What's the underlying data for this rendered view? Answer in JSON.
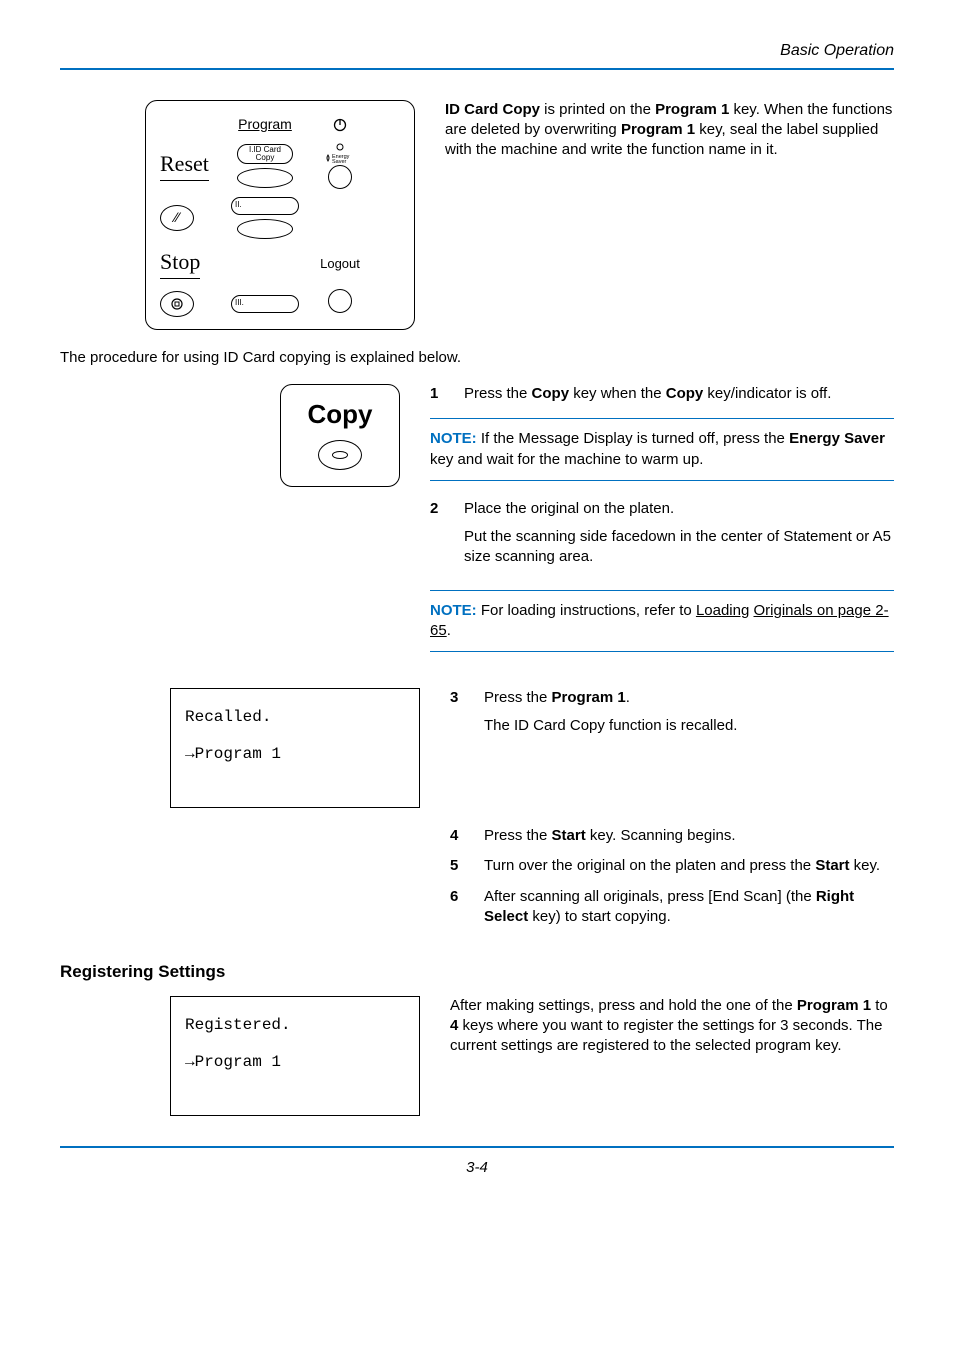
{
  "header": {
    "section": "Basic Operation"
  },
  "panel": {
    "reset": "Reset",
    "stop": "Stop",
    "program": "Program",
    "id_card_copy": "I.ID Card Copy",
    "energy_saver": "Energy\nSaver",
    "logout": "Logout",
    "slot2_prefix": "II.",
    "slot3_prefix": "III."
  },
  "intro_paragraph": {
    "pre1": "ID Card Copy",
    "mid1": " is printed on the ",
    "b2": "Program 1",
    "mid2": " key. When the functions are deleted by overwriting ",
    "b3": "Program 1",
    "post": " key, seal the label supplied with the machine and write the function name in it."
  },
  "procedure_intro": "The procedure for using ID Card copying is explained below.",
  "copy_box_title": "Copy",
  "steps": {
    "s1": {
      "num": "1",
      "pre": "Press the ",
      "b1": "Copy",
      "mid": " key when the ",
      "b2": "Copy",
      "post": " key/indicator is off."
    },
    "note1": {
      "label": "NOTE:",
      "pre": " If the Message Display is turned off, press the ",
      "b": "Energy Saver",
      "post": " key and wait for the machine to warm up."
    },
    "s2": {
      "num": "2",
      "line1": "Place the original on the platen.",
      "line2": "Put the scanning side facedown in the center of Statement or A5 size scanning area."
    },
    "note2": {
      "label": "NOTE:",
      "pre": " For loading instructions, refer to ",
      "u1": "Loading",
      "u2": "Originals on page 2-65",
      "post": "."
    },
    "s3": {
      "num": "3",
      "pre": "Press the ",
      "b": "Program 1",
      "post": ".",
      "line2": "The ID Card Copy function is recalled."
    },
    "s4": {
      "num": "4",
      "pre": "Press the ",
      "b": "Start",
      "post": " key. Scanning begins."
    },
    "s5": {
      "num": "5",
      "pre": "Turn over the original on the platen and press the ",
      "b": "Start",
      "post": " key."
    },
    "s6": {
      "num": "6",
      "pre": "After scanning all originals, press [End Scan] (the ",
      "b": "Right Select",
      "post": " key) to start copying."
    }
  },
  "lcd1": {
    "line1": "Recalled.",
    "line2": "→Program 1"
  },
  "registering_heading": "Registering Settings",
  "lcd2": {
    "line1": "Registered.",
    "line2": "→Program 1"
  },
  "registering_paragraph": {
    "pre": "After making settings, press and hold the one of the ",
    "b1": "Program 1",
    "mid1": " to ",
    "b2": "4",
    "post": " keys where you want to register the settings for 3 seconds. The current settings are registered to the selected program key."
  },
  "page_number": "3-4"
}
